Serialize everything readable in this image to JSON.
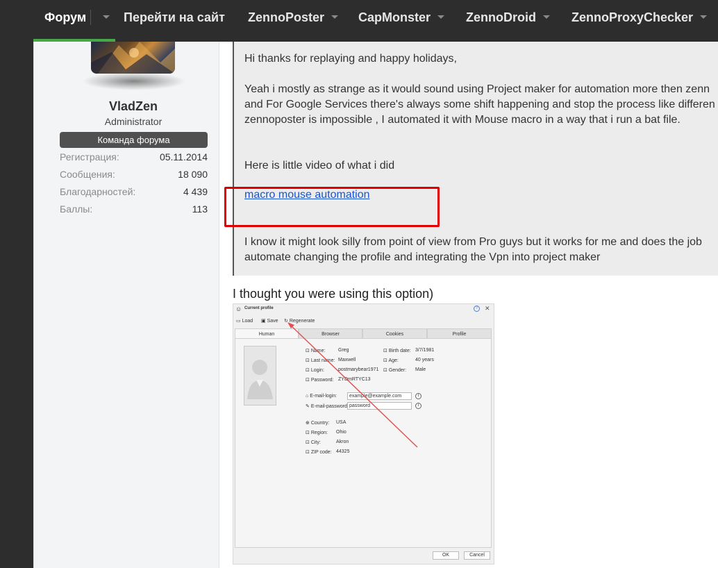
{
  "nav": {
    "items": [
      "Форум",
      "Перейти на сайт",
      "ZennoPoster",
      "CapMonster",
      "ZennoDroid",
      "ZennoProxyChecker"
    ],
    "active_index": 0
  },
  "user": {
    "name": "VladZen",
    "role": "Administrator",
    "badge": "Команда форума",
    "stats": [
      {
        "label": "Регистрация:",
        "value": "05.11.2014"
      },
      {
        "label": "Сообщения:",
        "value": "18 090"
      },
      {
        "label": "Благодарностей:",
        "value": "4 439"
      },
      {
        "label": "Баллы:",
        "value": "113"
      }
    ]
  },
  "quote": {
    "line1": "Hi thanks for replaying and happy holidays,",
    "line2": "Yeah i mostly as strange as it would sound using Project maker for automation more then zenn",
    "line3": "and For Google Services there's always some shift happening and stop the process like differen",
    "line4": "zennoposter is impossible , I automated it with Mouse macro in a way that i run a bat file.",
    "line5": "Here is little video of what i did",
    "link": "macro mouse automation",
    "line6": "I know it might look silly from point of view from Pro guys but it works for me and does the job",
    "line7": "automate changing the profile and integrating the Vpn into project maker"
  },
  "reply": {
    "text": "I thought you were using this option)"
  },
  "screenshot": {
    "title": "Current profile",
    "help": "?",
    "close": "✕",
    "toolbar": [
      "Load",
      "Save",
      "Regenerate"
    ],
    "tabs": [
      "Human",
      "Browser",
      "Cookies",
      "Profile"
    ],
    "fields_left": [
      {
        "label": "Name:",
        "value": "Greg"
      },
      {
        "label": "Last name:",
        "value": "Maxwell"
      },
      {
        "label": "Login:",
        "value": "postmarybear1971"
      },
      {
        "label": "Password:",
        "value": "ZYDmRTYC13"
      }
    ],
    "fields_right": [
      {
        "label": "Birth date:",
        "value": "3/7/1981"
      },
      {
        "label": "Age:",
        "value": "40 years"
      },
      {
        "label": "Gender:",
        "value": "Male"
      }
    ],
    "email_login_label": "E-mail-login:",
    "email_login_value": "example@example.com",
    "email_password_label": "E-mail-password:",
    "email_password_value": "password",
    "location": [
      {
        "label": "Country:",
        "value": "USA"
      },
      {
        "label": "Region:",
        "value": "Ohio"
      },
      {
        "label": "City:",
        "value": "Akron"
      },
      {
        "label": "ZIP code:",
        "value": "44325"
      }
    ],
    "ok": "OK",
    "cancel": "Cancel",
    "colors": {
      "arrow": "#e05050"
    }
  }
}
